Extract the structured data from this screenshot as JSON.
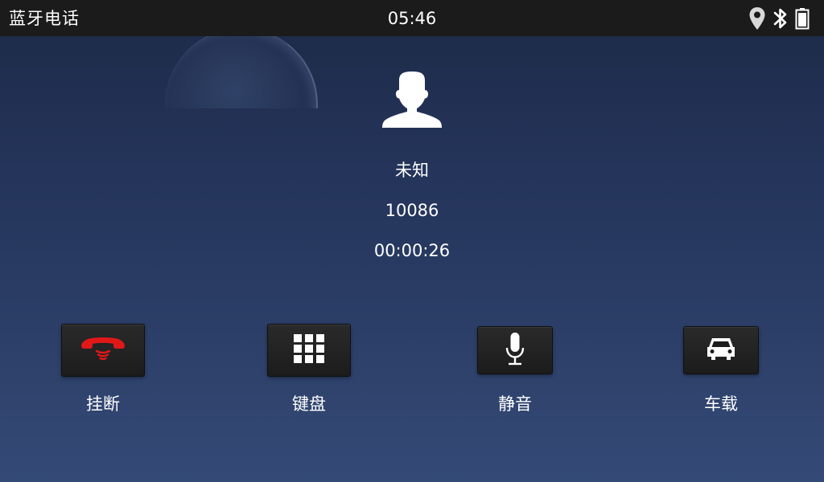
{
  "status_bar": {
    "app_title": "蓝牙电话",
    "time": "05:46",
    "icons": [
      "location-pin-icon",
      "bluetooth-icon",
      "battery-icon"
    ]
  },
  "caller": {
    "avatar_icon": "person-icon",
    "name": "未知",
    "number": "10086",
    "duration": "00:00:26"
  },
  "actions": [
    {
      "label": "挂断",
      "icon": "hangup-phone-icon",
      "color": "#e01818"
    },
    {
      "label": "键盘",
      "icon": "keypad-icon"
    },
    {
      "label": "静音",
      "icon": "microphone-icon"
    },
    {
      "label": "车载",
      "icon": "car-icon"
    }
  ],
  "colors": {
    "status_bar_bg": "#1b1b1b",
    "background_top": "#1d2a47",
    "background_bottom": "#344a76",
    "button_bg": "#1c1c1c",
    "hangup_red": "#e01818",
    "text": "#ffffff"
  }
}
